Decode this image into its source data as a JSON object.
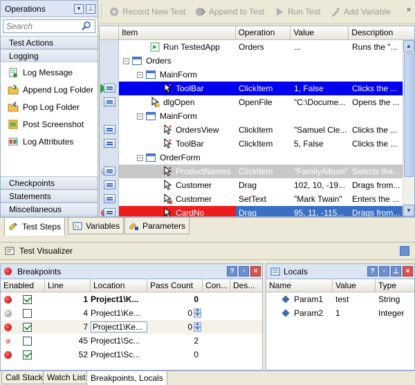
{
  "operations": {
    "title": "Operations",
    "search_placeholder": "Search",
    "groups_top": [
      "Test Actions",
      "Logging"
    ],
    "items": [
      {
        "label": "Log Message",
        "icon": "log-message-icon"
      },
      {
        "label": "Append Log Folder",
        "icon": "append-log-folder-icon"
      },
      {
        "label": "Pop Log Folder",
        "icon": "pop-log-folder-icon"
      },
      {
        "label": "Post Screenshot",
        "icon": "post-screenshot-icon"
      },
      {
        "label": "Log Attributes",
        "icon": "log-attributes-icon"
      }
    ],
    "groups_bottom": [
      "Checkpoints",
      "Statements",
      "Miscellaneous"
    ]
  },
  "toolbar": {
    "record": "Record New Test",
    "append": "Append to Test",
    "run": "Run Test",
    "add_variable": "Add Variable"
  },
  "grid": {
    "headers": [
      "Item",
      "Operation",
      "Value",
      "Description"
    ],
    "rows": [
      {
        "item": "Run TestedApp",
        "op": "Orders",
        "val": "...",
        "desc": "Runs the \"..."
      },
      {
        "item": "Orders",
        "op": "",
        "val": "",
        "desc": ""
      },
      {
        "item": "MainForm",
        "op": "",
        "val": "",
        "desc": ""
      },
      {
        "item": "ToolBar",
        "op": "ClickItem",
        "val": "1, False",
        "desc": "Clicks the ..."
      },
      {
        "item": "dlgOpen",
        "op": "OpenFile",
        "val": "\"C:\\Docume...",
        "desc": "Opens the ..."
      },
      {
        "item": "MainForm",
        "op": "",
        "val": "",
        "desc": ""
      },
      {
        "item": "OrdersView",
        "op": "ClickItem",
        "val": "\"Samuel Cle...",
        "desc": "Clicks the ..."
      },
      {
        "item": "ToolBar",
        "op": "ClickItem",
        "val": "5, False",
        "desc": "Clicks the ..."
      },
      {
        "item": "OrderForm",
        "op": "",
        "val": "",
        "desc": ""
      },
      {
        "item": "ProductNames",
        "op": "ClickItem",
        "val": "\"FamilyAlbum\"",
        "desc": "Selects the..."
      },
      {
        "item": "Customer",
        "op": "Drag",
        "val": "102, 10, -19...",
        "desc": "Drags from..."
      },
      {
        "item": "Customer",
        "op": "SetText",
        "val": "\"Mark Twain\"",
        "desc": "Enters the ..."
      },
      {
        "item": "CardNo",
        "op": "Drag",
        "val": "95, 11, -115...",
        "desc": "Drags from..."
      }
    ]
  },
  "tabs_top": [
    "Test Steps",
    "Variables",
    "Parameters"
  ],
  "visualizer": {
    "title": "Test Visualizer"
  },
  "breakpoints": {
    "title": "Breakpoints",
    "headers": [
      "Enabled",
      "Line",
      "Location",
      "Pass Count",
      "Con...",
      "Des..."
    ],
    "rows": [
      {
        "line": "1",
        "location": "Project1\\K...",
        "pass": "0",
        "cond": "",
        "enabled": true
      },
      {
        "line": "4",
        "location": "Project1\\Ke...",
        "pass": "0",
        "cond": "",
        "enabled": false
      },
      {
        "line": "7",
        "location": "Project1\\Ke...",
        "pass": "0",
        "cond": "",
        "enabled": true
      },
      {
        "line": "45",
        "location": "Project1\\Sc...",
        "pass": "2",
        "cond": "",
        "enabled": false
      },
      {
        "line": "52",
        "location": "Project1\\Sc...",
        "pass": "0",
        "cond": "",
        "enabled": true
      }
    ]
  },
  "locals": {
    "title": "Locals",
    "headers": [
      "Name",
      "Value",
      "Type"
    ],
    "rows": [
      {
        "name": "Param1",
        "value": "test",
        "type": "String"
      },
      {
        "name": "Param2",
        "value": "1",
        "type": "Integer"
      }
    ]
  },
  "tabs_bottom": [
    "Call Stack",
    "Watch List",
    "Breakpoints, Locals"
  ],
  "colors": {
    "selection": "#0000ee",
    "breakpoint": "#ee1c1c",
    "panel_header": "#dbe5f3"
  }
}
